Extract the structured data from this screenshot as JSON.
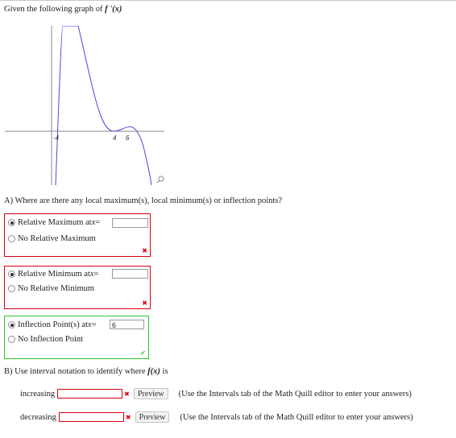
{
  "prompt": {
    "text": "Given the following graph of ",
    "func": "f '(x)"
  },
  "graph": {
    "tick_labels": [
      "-4",
      "4",
      "6"
    ]
  },
  "part_a": {
    "question": "A) Where are there any local maximum(s), local minimum(s) or inflection points?",
    "max": {
      "option1": "Relative Maximum at ",
      "var": "x",
      "eq": " =",
      "value": "",
      "option2": "No Relative Maximum",
      "status": "incorrect"
    },
    "min": {
      "option1": "Relative Minimum at ",
      "var": "x",
      "eq": " =",
      "value": "",
      "option2": "No Relative Minimum",
      "status": "incorrect"
    },
    "inflection": {
      "option1": "Inflection Point(s) at ",
      "var": "x",
      "eq": " =",
      "value": "6",
      "option2": "No Inflection Point",
      "status": "correct"
    }
  },
  "part_b": {
    "prefix": "B) Use interval notation to identify where ",
    "func": "f(x)",
    "suffix": " is",
    "rows": [
      {
        "label": "increasing",
        "value": "",
        "preview": "Preview",
        "hint": "(Use the Intervals tab of the Math Quill editor to enter your answers)"
      },
      {
        "label": "decreasing",
        "value": "",
        "preview": "Preview",
        "hint": "(Use the Intervals tab of the Math Quill editor to enter your answers)"
      }
    ]
  },
  "colors": {
    "curve": "#4a4ad6",
    "axis": "#8a8a8a",
    "error": "#d9000f",
    "ok": "#2ec22e"
  },
  "icons": {
    "zoom": "magnifier-icon",
    "error": "x-mark-icon",
    "ok": "check-mark-icon"
  }
}
